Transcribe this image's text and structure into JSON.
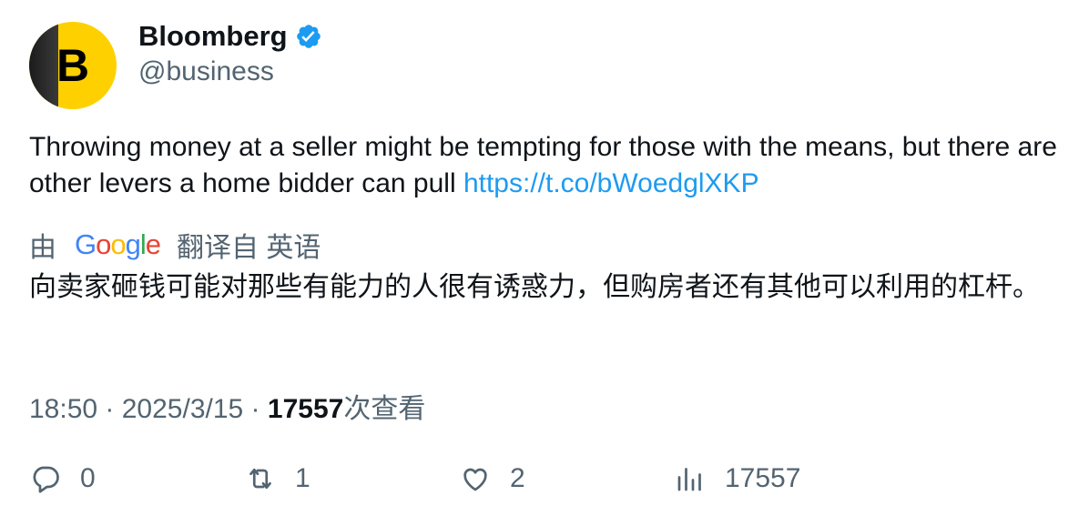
{
  "author": {
    "name": "Bloomberg",
    "handle": "@business",
    "avatar_letter": "B",
    "verified": true,
    "brand_color": "#ffd000"
  },
  "tweet": {
    "text": "Throwing money at a seller might be tempting for those with the means, but there are other levers a home bidder can pull ",
    "link": "https://t.co/bWoedglXKP",
    "link_color": "#1d9bf0"
  },
  "translation": {
    "prefix": "由",
    "provider": "Google",
    "suffix": "翻译自 英语",
    "text": "向卖家砸钱可能对那些有能力的人很有诱惑力，但购房者还有其他可以利用的杠杆。"
  },
  "meta": {
    "time": "18:50",
    "separator": " · ",
    "date": "2025/3/15",
    "views_count": "17557",
    "views_label": "次查看"
  },
  "actions": {
    "replies": "0",
    "retweets": "1",
    "likes": "2",
    "views": "17557"
  },
  "icons": [
    "verified-badge-icon",
    "reply-icon",
    "retweet-icon",
    "like-icon",
    "views-icon"
  ]
}
